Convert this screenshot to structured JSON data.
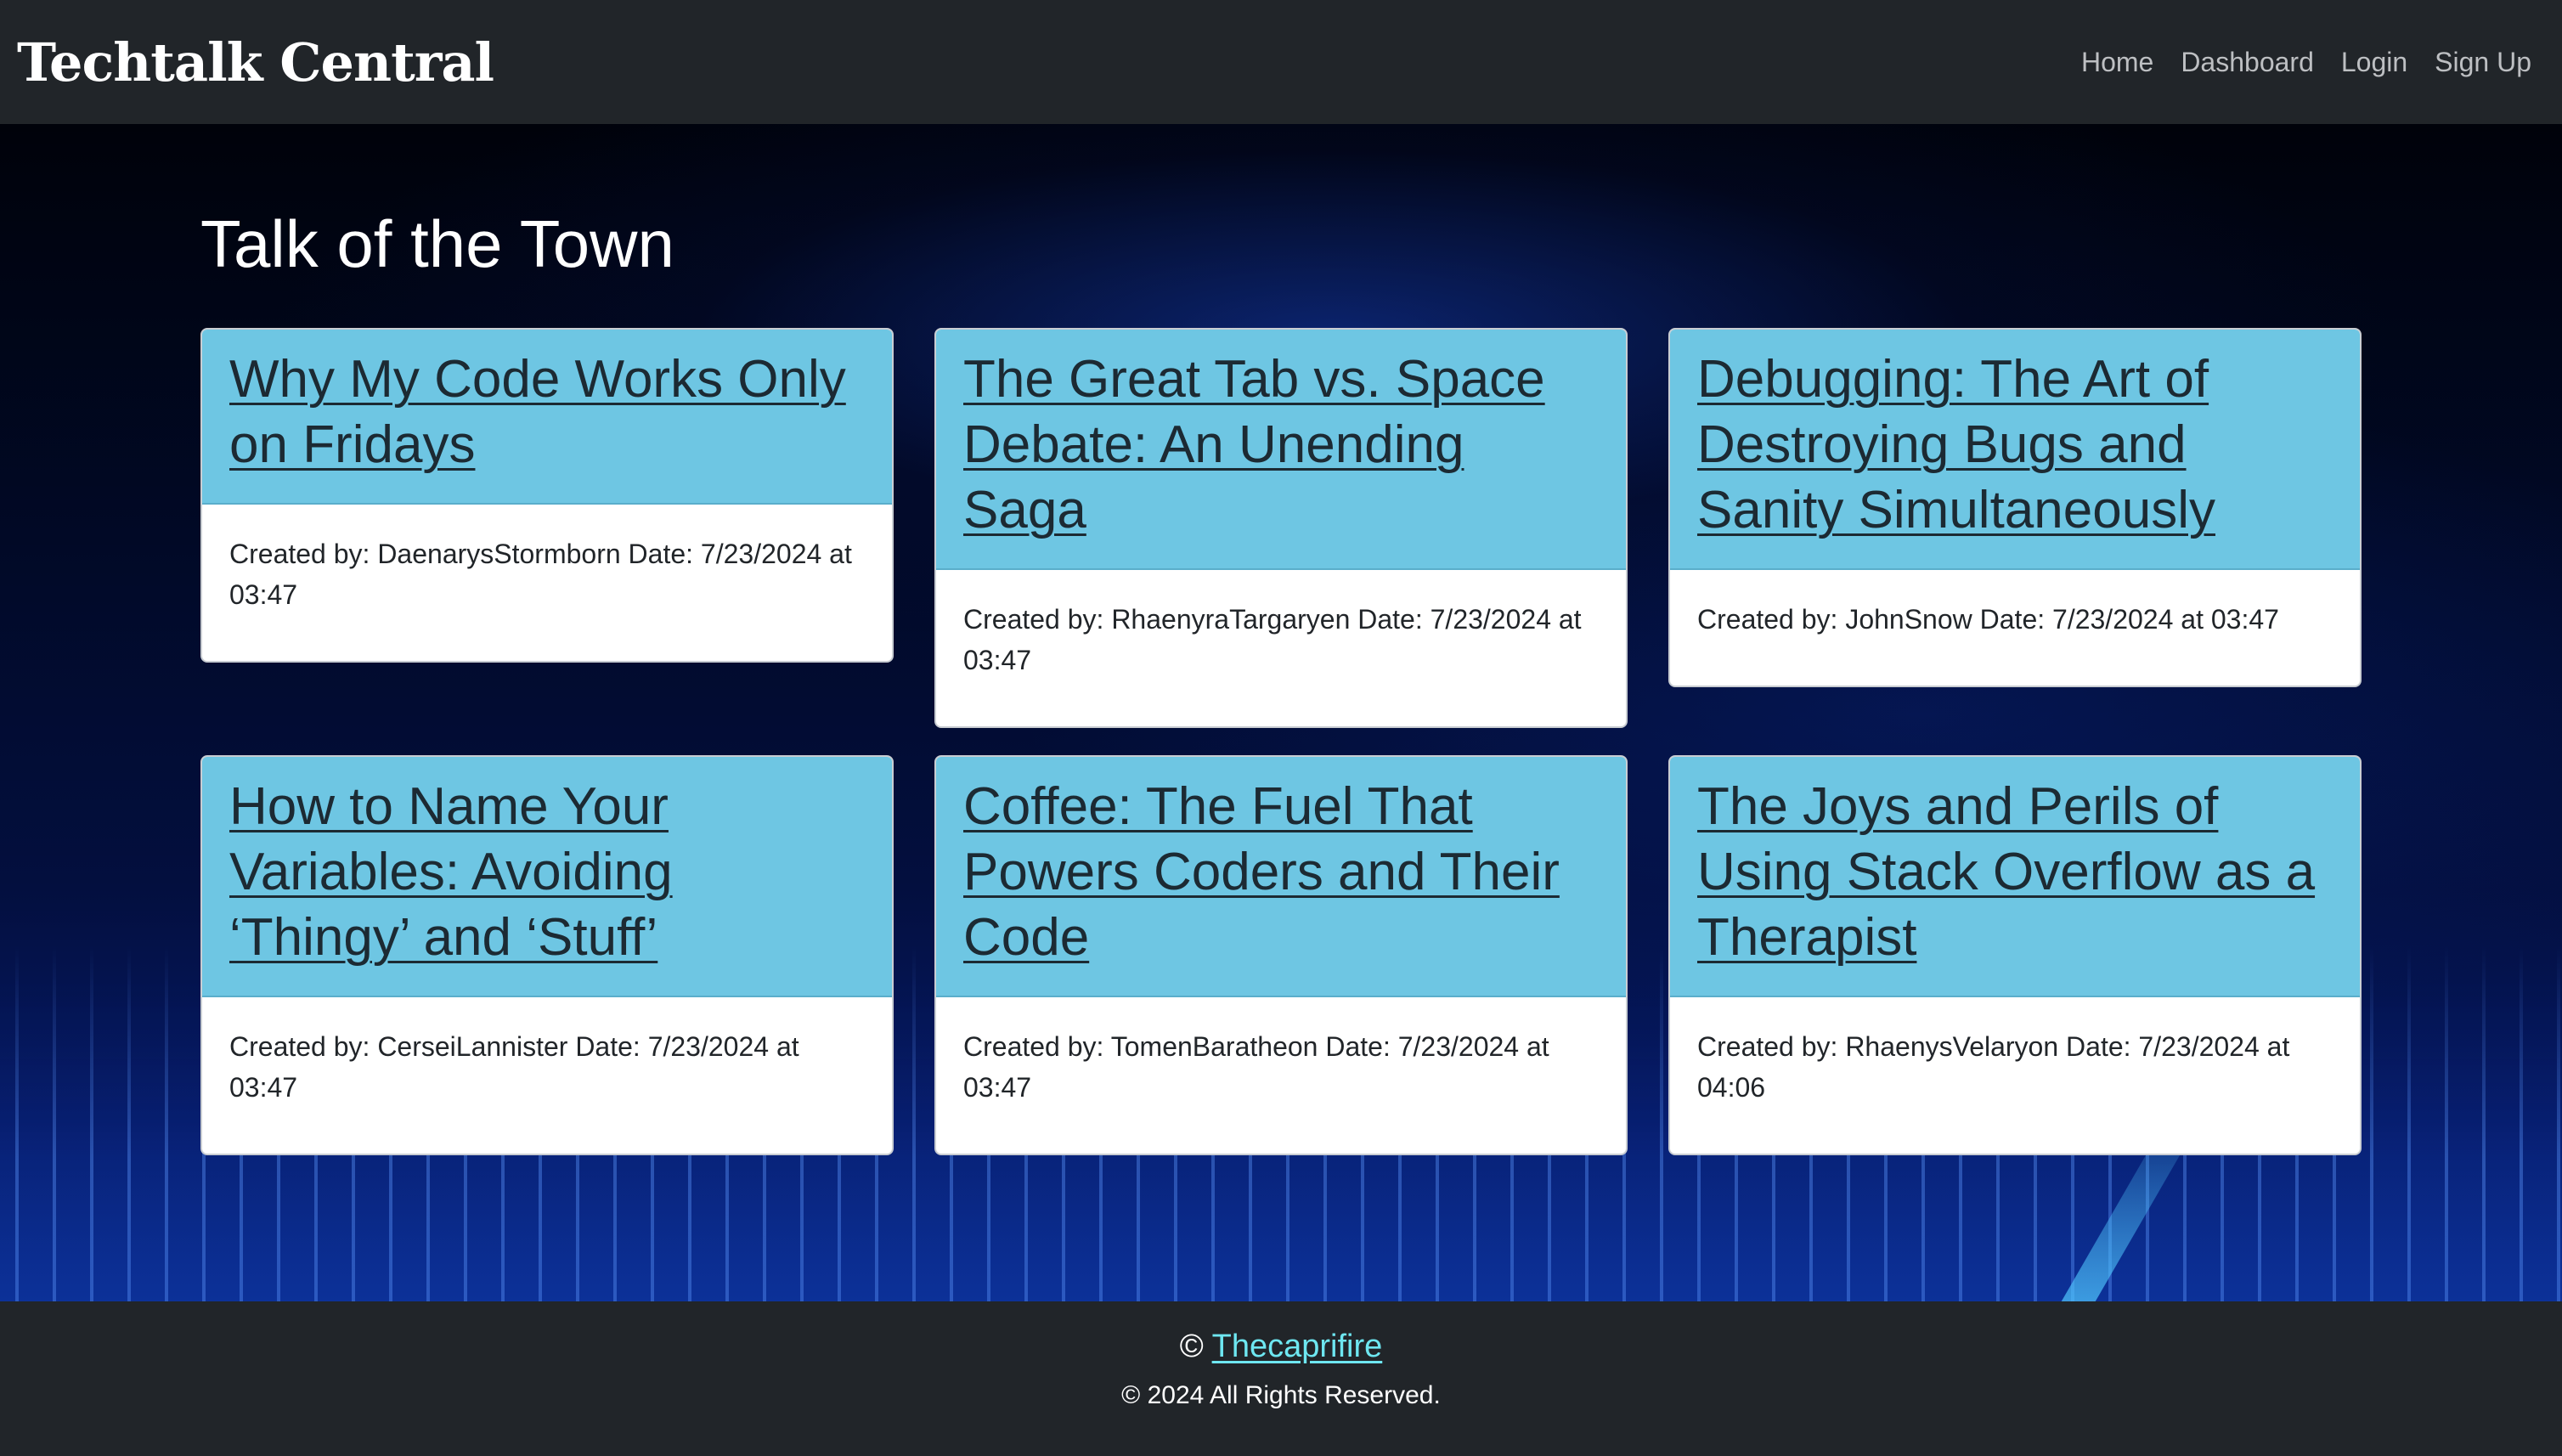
{
  "navbar": {
    "brand": "Techtalk Central",
    "links": [
      "Home",
      "Dashboard",
      "Login",
      "Sign Up"
    ]
  },
  "main": {
    "title": "Talk of the Town",
    "posts": [
      {
        "title": "Why My Code Works Only on Fridays",
        "meta": "Created by: DaenarysStormborn Date: 7/23/2024 at 03:47"
      },
      {
        "title": "The Great Tab vs. Space Debate: An Unending Saga",
        "meta": "Created by: RhaenyraTargaryen Date: 7/23/2024 at 03:47"
      },
      {
        "title": "Debugging: The Art of Destroying Bugs and Sanity Simultaneously",
        "meta": "Created by: JohnSnow Date: 7/23/2024 at 03:47"
      },
      {
        "title": "How to Name Your Variables: Avoiding ‘Thingy’ and ‘Stuff’",
        "meta": "Created by: CerseiLannister Date: 7/23/2024 at 03:47"
      },
      {
        "title": "Coffee: The Fuel That Powers Coders and Their Code",
        "meta": "Created by: TomenBaratheon Date: 7/23/2024 at 03:47"
      },
      {
        "title": "The Joys and Perils of Using Stack Overflow as a Therapist",
        "meta": "Created by: RhaenysVelaryon Date: 7/23/2024 at 04:06"
      }
    ]
  },
  "footer": {
    "copyright_symbol": "©",
    "author_link": "Thecaprifire",
    "rights": "© 2024 All Rights Reserved."
  },
  "colors": {
    "navbar_bg": "#212529",
    "card_header_bg": "#6ec6e3",
    "footer_link": "#6ee7f1"
  }
}
